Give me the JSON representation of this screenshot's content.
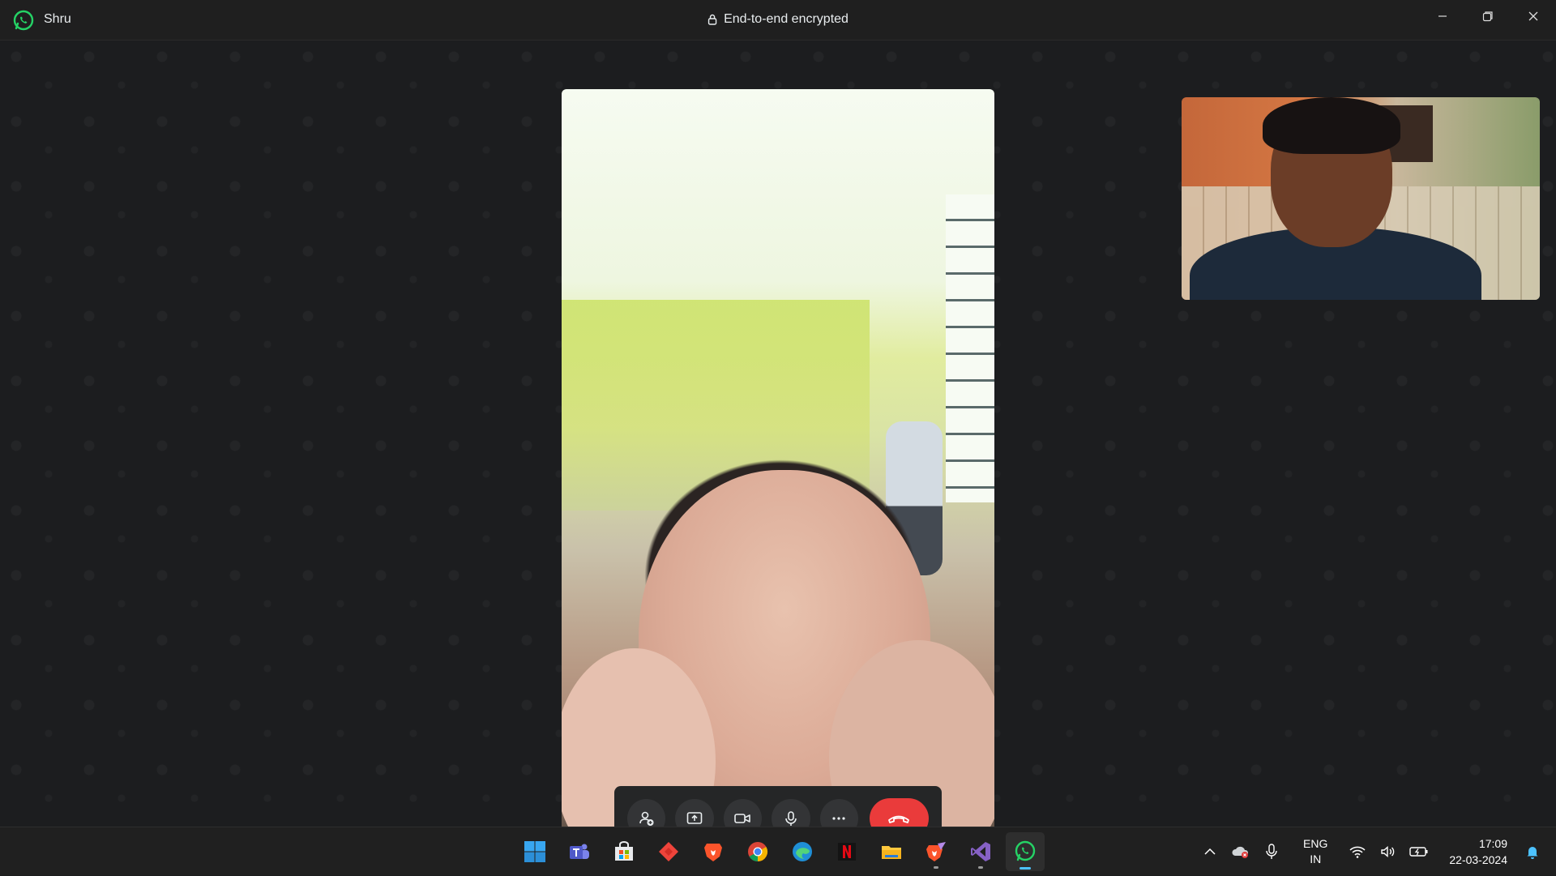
{
  "titlebar": {
    "contact_name": "Shru",
    "encryption_text": "End-to-end encrypted",
    "icons": [
      "whatsapp-logo-icon",
      "lock-icon",
      "minimize-icon",
      "restore-icon",
      "close-icon"
    ]
  },
  "call": {
    "controls": [
      "add-participant-icon",
      "share-screen-icon",
      "video-camera-icon",
      "microphone-icon",
      "more-options-icon",
      "end-call-icon"
    ],
    "end_call_color": "#ea3b3b"
  },
  "taskbar": {
    "apps": [
      "windows-start",
      "microsoft-teams",
      "microsoft-store",
      "anydesk",
      "brave-browser",
      "google-chrome",
      "microsoft-edge",
      "netflix",
      "file-explorer",
      "brave-nightly",
      "visual-studio",
      "whatsapp"
    ],
    "active_app": "whatsapp",
    "language_top": "ENG",
    "language_bottom": "IN",
    "time": "17:09",
    "date": "22-03-2024"
  },
  "colors": {
    "whatsapp_green": "#25d366",
    "accent_blue": "#4cc2ff"
  }
}
